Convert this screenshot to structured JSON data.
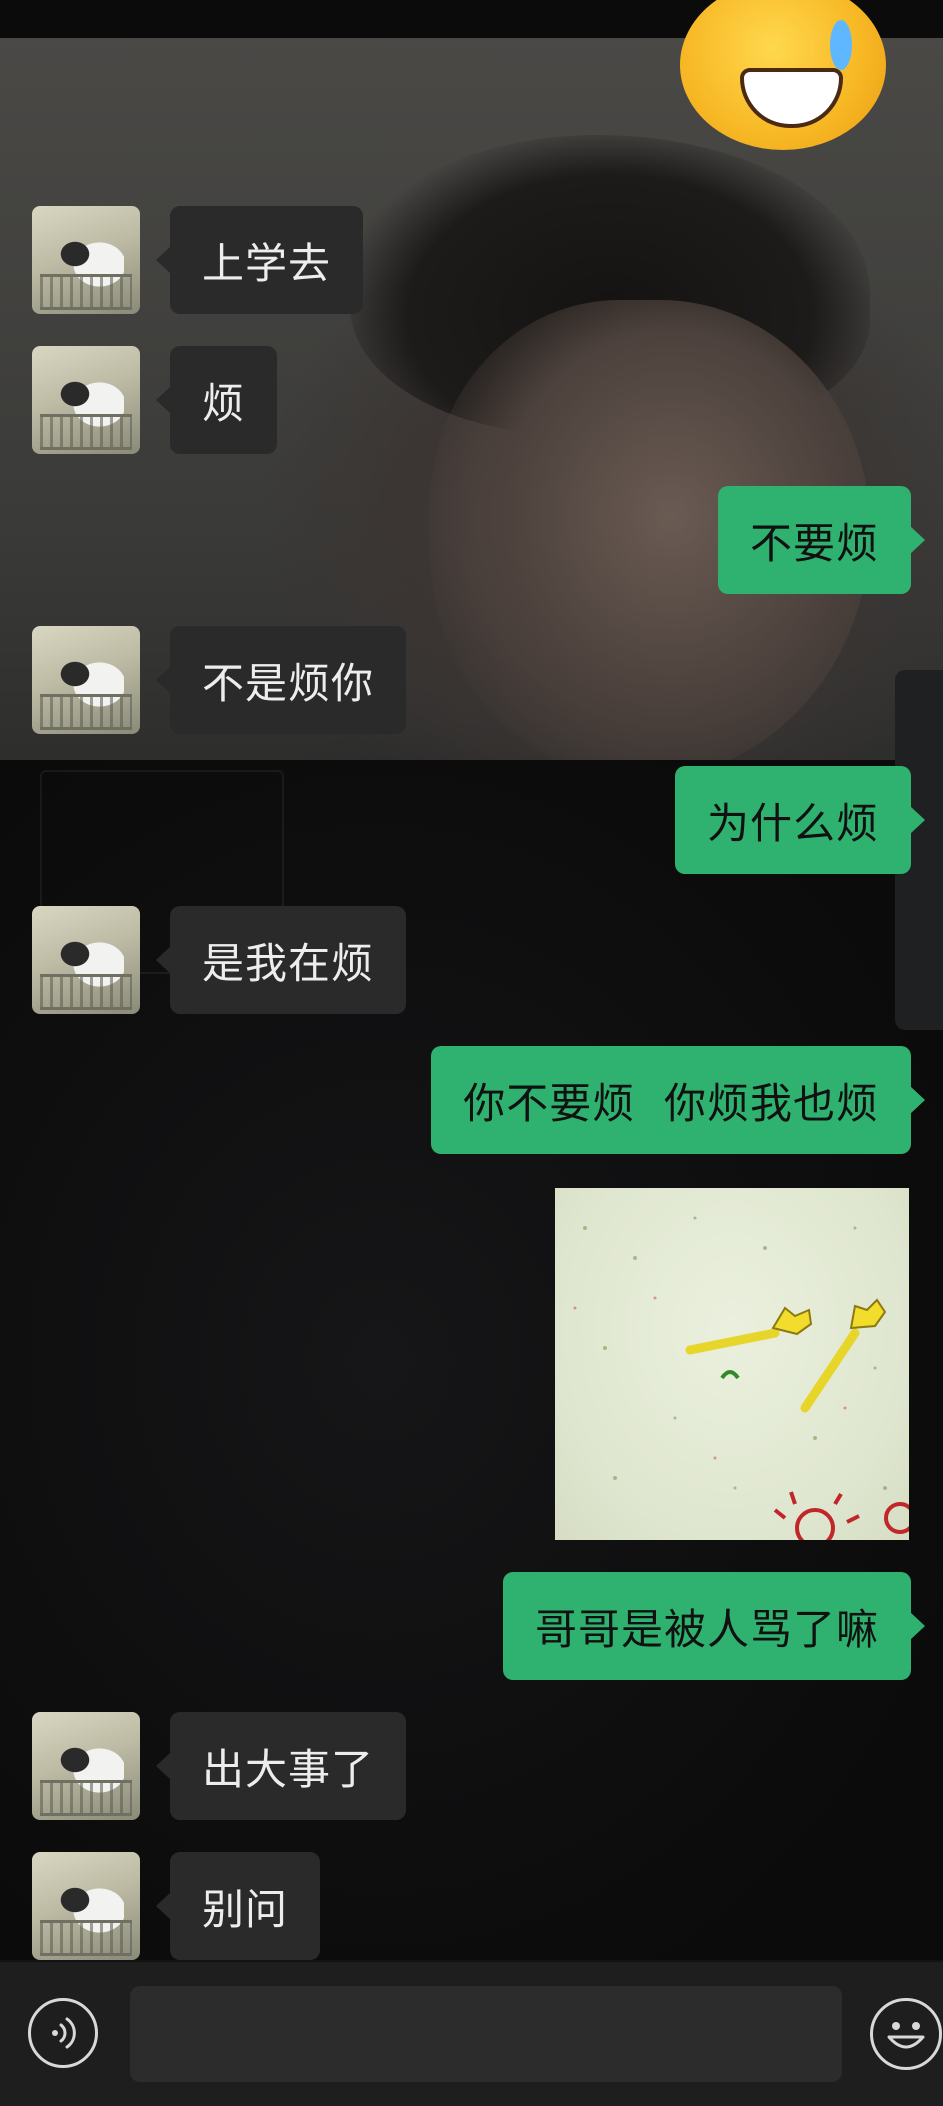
{
  "conversation": {
    "messages": [
      {
        "side": "left",
        "text": "上学去"
      },
      {
        "side": "left",
        "text": "烦"
      },
      {
        "side": "right",
        "text": "不要烦"
      },
      {
        "side": "left",
        "text": "不是烦你"
      },
      {
        "side": "right",
        "text": "为什么烦"
      },
      {
        "side": "left",
        "text": "是我在烦"
      },
      {
        "side": "right",
        "text": "你不要烦  你烦我也烦"
      },
      {
        "side": "right",
        "type": "image",
        "description": "sticker-hands-waving"
      },
      {
        "side": "right",
        "text": "哥哥是被人骂了嘛"
      },
      {
        "side": "left",
        "text": "出大事了"
      },
      {
        "side": "left",
        "text": "别问"
      }
    ]
  },
  "input_bar": {
    "voice_icon": "voice-icon",
    "emoji_icon": "smiley-icon",
    "text_value": ""
  },
  "colors": {
    "sent_bubble": "#2fb26f",
    "received_bubble": "#2a2a2a",
    "input_bar": "#1e1e1e"
  }
}
